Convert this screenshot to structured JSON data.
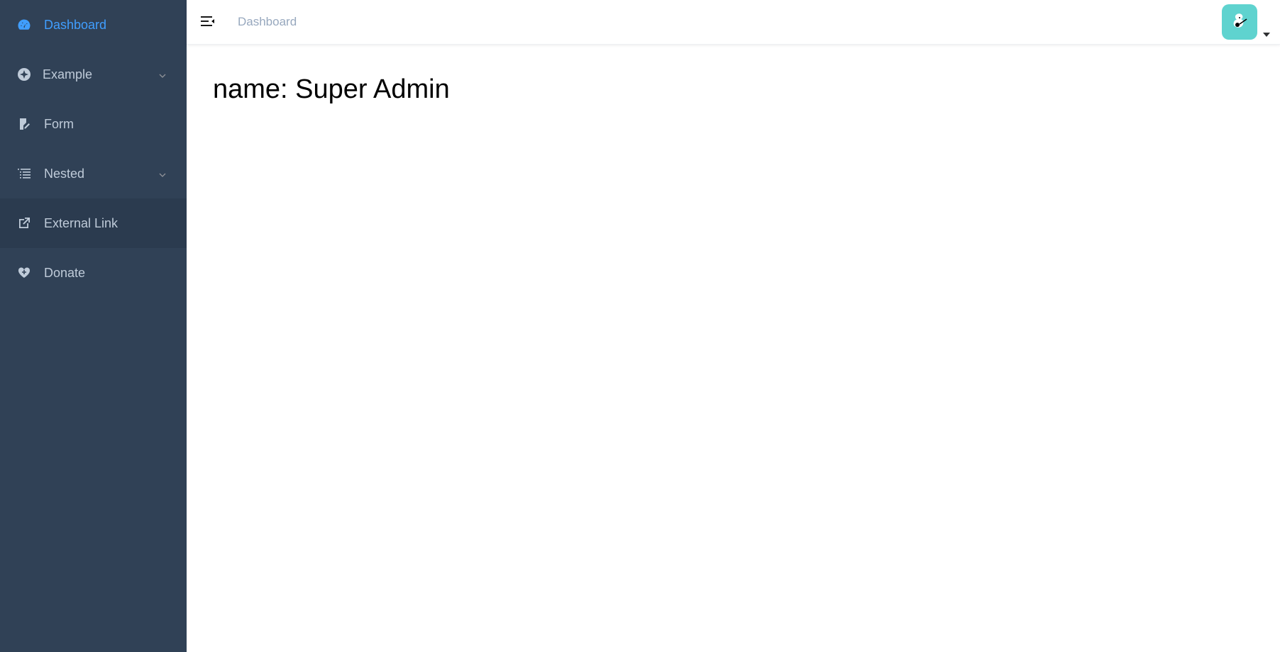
{
  "sidebar": {
    "items": [
      {
        "label": "Dashboard",
        "icon": "dashboard-icon",
        "active": true
      },
      {
        "label": "Example",
        "icon": "example-icon",
        "expandable": true
      },
      {
        "label": "Form",
        "icon": "form-icon"
      },
      {
        "label": "Nested",
        "icon": "nested-icon",
        "expandable": true
      },
      {
        "label": "External Link",
        "icon": "link-icon"
      },
      {
        "label": "Donate",
        "icon": "donate-icon"
      }
    ]
  },
  "navbar": {
    "breadcrumb": "Dashboard",
    "avatar_color": "#5fd3cf"
  },
  "main": {
    "name_text": "name: Super Admin"
  },
  "colors": {
    "sidebar_bg": "#304156",
    "sidebar_text": "#bfcbd9",
    "active_text": "#409eff",
    "breadcrumb": "#97a8be"
  }
}
